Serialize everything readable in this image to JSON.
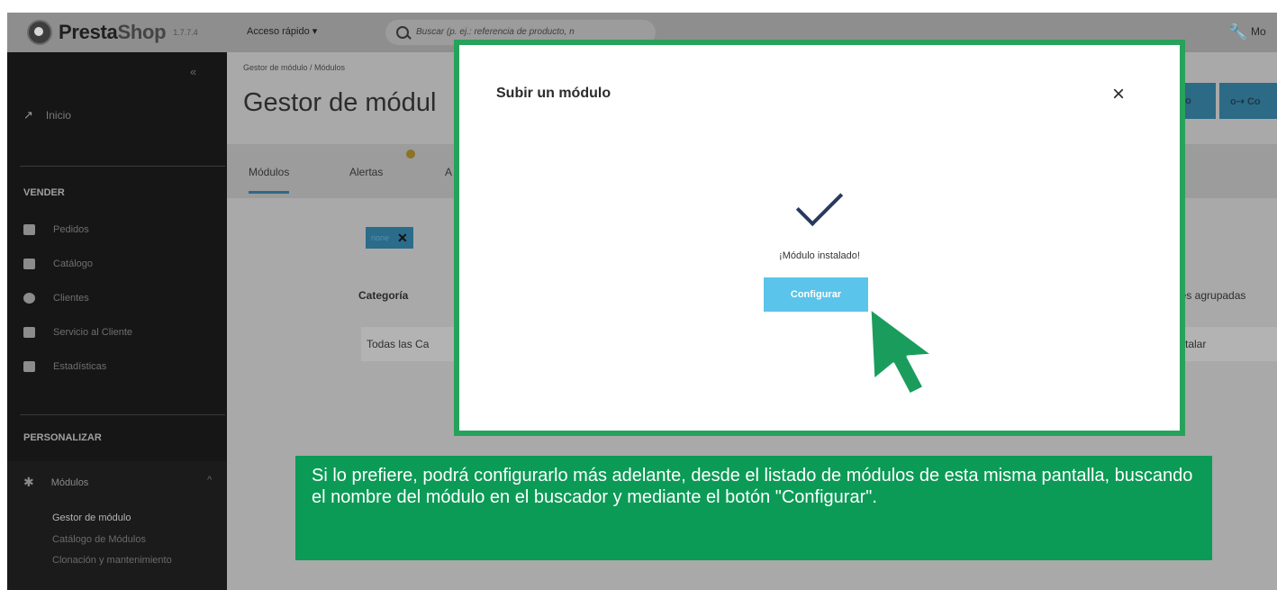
{
  "topbar": {
    "brand": "PrestaShop",
    "brand_main": "Presta",
    "brand_accent": "Shop",
    "version": "1.7.7.4",
    "quick_access": "Acceso rápido ▾",
    "search_placeholder": "Buscar (p. ej.: referencia de producto, n",
    "tools_label": "Mo"
  },
  "sidebar": {
    "collapse": "«",
    "home": "Inicio",
    "sell_title": "VENDER",
    "sell_items": [
      "Pedidos",
      "Catálogo",
      "Clientes",
      "Servicio al Cliente",
      "Estadísticas"
    ],
    "customize_title": "PERSONALIZAR",
    "modules_label": "Módulos",
    "modules_chevron": "^",
    "modules_items": [
      "Gestor de módulo",
      "Catálogo de Módulos",
      "Clonación y mantenimiento"
    ]
  },
  "main": {
    "breadcrumb": "Gestor de módulo  /  Módulos",
    "title": "Gestor de módul",
    "upload_btn": "o",
    "connect_btn": "o⇢ Co",
    "tabs": [
      "Módulos",
      "Alertas",
      "A"
    ],
    "filter_chip": "none",
    "filter_chip_close": "✕",
    "category_label": "Categoría",
    "category_value": "Todas las Ca",
    "grouped_label": "nes agrupadas",
    "grouped_value": "stalar"
  },
  "modal": {
    "title": "Subir un módulo",
    "close": "×",
    "status": "¡Módulo instalado!",
    "configure": "Configurar"
  },
  "caption": "Si lo prefiere, podrá configurarlo más adelante, desde el listado de módulos de esta misma pantalla, buscando el nombre del módulo en el buscador y mediante el botón \"Configurar\".",
  "colors": {
    "accent_green": "#27a25b",
    "configure_blue": "#5ac4ea",
    "check_navy": "#273a5e",
    "caption_bg": "#0b9b56"
  }
}
